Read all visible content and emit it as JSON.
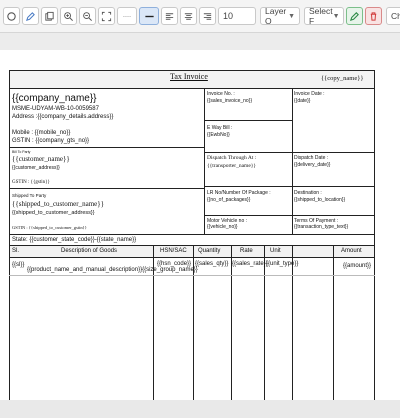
{
  "toolbar": {
    "font_size": "10",
    "layer_select": "Layer O",
    "font_select": "Select F",
    "cut_label": "Ch"
  },
  "invoice": {
    "title": "Tax Invoice",
    "copy_name": "{{copy_name}}",
    "company_name": "{{company_name}}",
    "msme": "MSME-UDYAM-WB-10-0059587",
    "address": "Address :{{company_details.address}}",
    "mobile": "Mobile : {{mobile_no}}",
    "gstin": "GSTIN : {{company_gts_no}}",
    "invoice_no_label": "Invoice No. :",
    "invoice_no": "{{sales_invoice_no}}",
    "invoice_date_label": "Invoice Date :",
    "invoice_date": "{{date}}",
    "eway_label": "E Way Bill :",
    "eway": "{{EwbNo}}",
    "bill_to_label": "Bill To Party",
    "customer_name": "{{customer_name}}",
    "customer_address": "{{customer_address}}",
    "customer_gstin": "GSTIN : {{gstin}}",
    "dispatch_through_label": "Dispatch Through At :",
    "transporter_name": "{{transporter_name}}",
    "dispatch_date_label": "Dispatch Date :",
    "delivery_date": "{{delivery_date}}",
    "ship_to_label": "Shipped To Party",
    "shipped_to_name": "{{shipped_to_customer_name}}",
    "shipped_to_address": "{{shipped_to_customer_address}}",
    "shipped_gstin": "GSTIN : {{shipped_to_customer_gstin}}",
    "lr_label": "LR No/Number Of Package :",
    "lr_value": "{{no_of_packages}}",
    "destination_label": "Destination :",
    "destination": "{{shipped_to_location}}",
    "vehicle_label": "Motor Vehicle no :",
    "vehicle": "{{vehicle_no}}",
    "terms_label": "Terms Of Payment :",
    "terms": "{{transaction_type_text}}",
    "state_line": "State: {{customer_state_code}}-{{state_name}}"
  },
  "items_table": {
    "headers": [
      "Sl.",
      "Description of Goods",
      "HSN/SAC",
      "Quantity",
      "Rate",
      "Unit",
      "Amount"
    ],
    "row": {
      "sl": "{{sl}}",
      "description": "{{product_name_and_manual_description}}{{size_group_name}}",
      "hsn": "{{hsn_code}}",
      "qty": "{{sales_qty}}",
      "rate": "{{sales_rate}}",
      "unit": "{{unit_type}}",
      "amount": "{{amount}}"
    }
  },
  "colors": {
    "toolbar_bg": "#f4f4f4",
    "save_green": "#2e8b47",
    "delete_red": "#d23b3b",
    "header_bg": "#f2f2f2"
  }
}
